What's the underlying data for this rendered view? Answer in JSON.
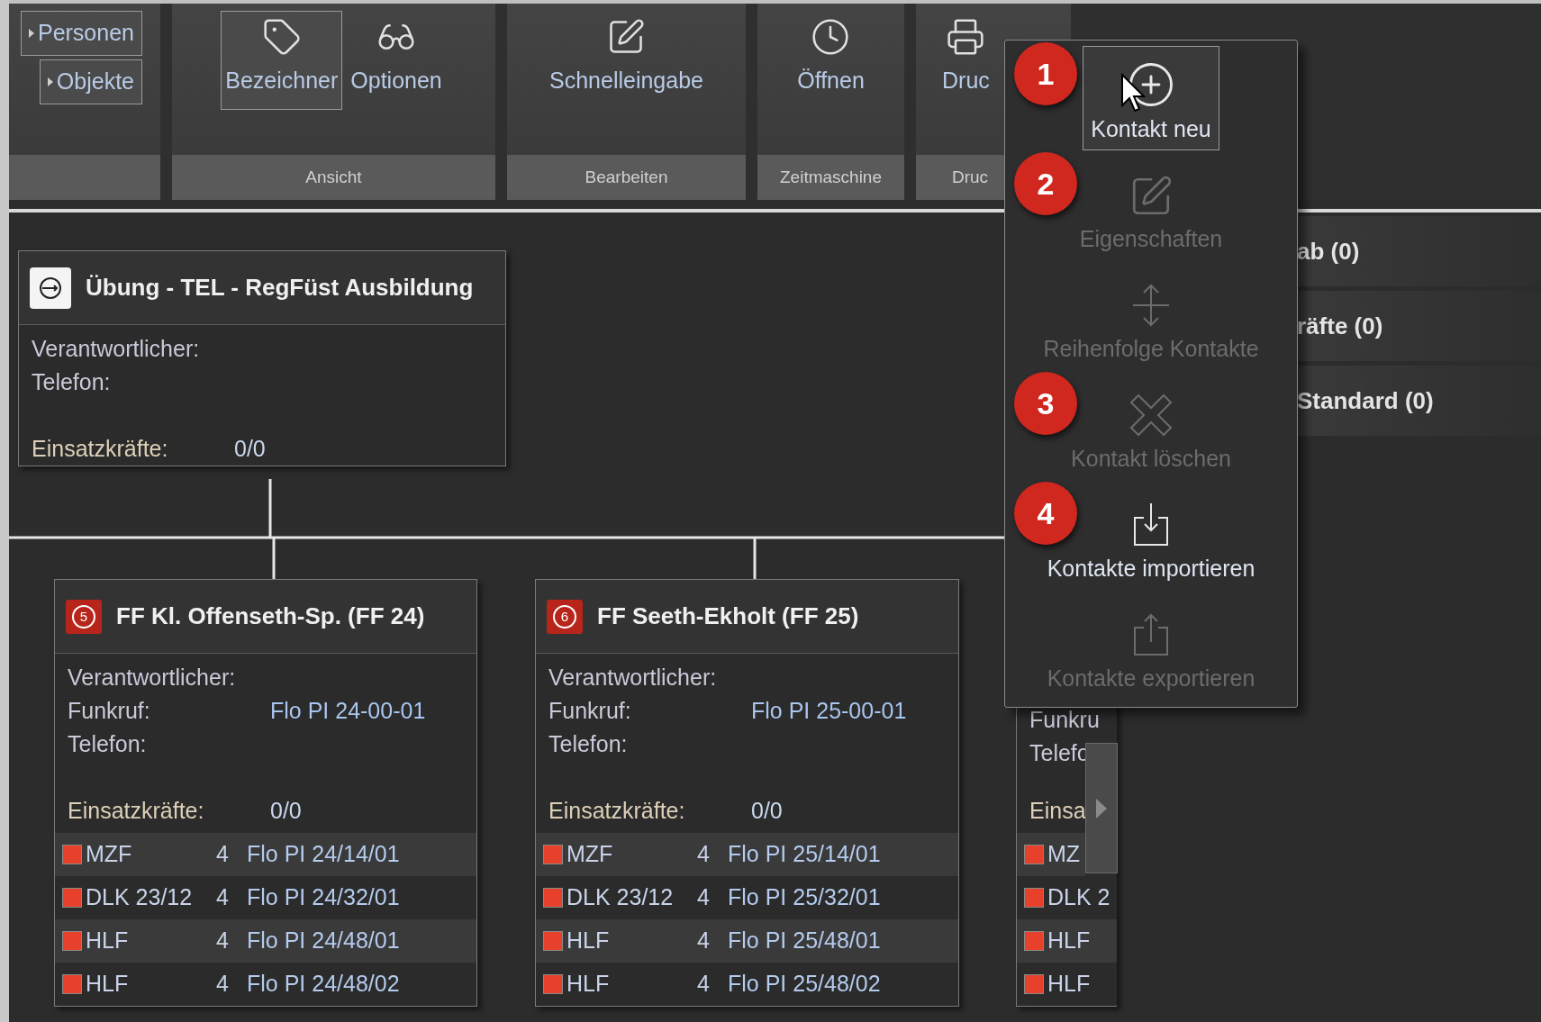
{
  "ribbon": {
    "groups": [
      {
        "buttons": [
          {
            "label": "Personen",
            "kind": "small",
            "selected": true
          },
          {
            "label": "Objekte",
            "kind": "small",
            "selected": true
          }
        ]
      },
      {
        "label": "Ansicht",
        "buttons": [
          {
            "label": "Bezeichner",
            "kind": "tag",
            "selected": true
          },
          {
            "label": "Optionen",
            "kind": "glasses",
            "selected": false
          }
        ]
      },
      {
        "label": "Bearbeiten",
        "buttons": [
          {
            "label": "Schnelleingabe",
            "kind": "edit",
            "selected": false
          }
        ]
      },
      {
        "label": "Zeitmaschine",
        "buttons": [
          {
            "label": "Öffnen",
            "kind": "clock",
            "selected": false
          }
        ]
      },
      {
        "label": "Druc",
        "buttons": [
          {
            "label": "Druc",
            "kind": "printer",
            "selected": false
          }
        ]
      }
    ]
  },
  "side_list": [
    "ab (0)",
    "räfte (0)",
    "Standard (0)"
  ],
  "cards": [
    {
      "kind": "exercise",
      "title": "Übung - TEL - RegFüst Ausbildung",
      "fields": [
        {
          "label": "Verantwortlicher:"
        },
        {
          "label": "Telefon:"
        }
      ],
      "strength": {
        "label": "Einsatzkräfte:",
        "value": "0/0"
      }
    },
    {
      "kind": "station",
      "badge": "5",
      "title": "FF Kl. Offenseth-Sp. (FF 24)",
      "fields": [
        {
          "label": "Verantwortlicher:"
        },
        {
          "label": "Funkruf:",
          "value": "Flo PI 24-00-01"
        },
        {
          "label": "Telefon:"
        }
      ],
      "strength": {
        "label": "Einsatzkräfte:",
        "value": "0/0"
      },
      "units": [
        {
          "name": "MZF",
          "crew": "4",
          "call": "Flo PI 24/14/01",
          "color": "#e8412b"
        },
        {
          "name": "DLK 23/12",
          "crew": "4",
          "call": "Flo PI 24/32/01",
          "color": "#e8412b"
        },
        {
          "name": "HLF",
          "crew": "4",
          "call": "Flo PI 24/48/01",
          "color": "#e8412b"
        },
        {
          "name": "HLF",
          "crew": "4",
          "call": "Flo PI 24/48/02",
          "color": "#e8412b"
        }
      ]
    },
    {
      "kind": "station",
      "badge": "6",
      "title": "FF Seeth-Ekholt (FF 25)",
      "fields": [
        {
          "label": "Verantwortlicher:"
        },
        {
          "label": "Funkruf:",
          "value": "Flo PI 25-00-01"
        },
        {
          "label": "Telefon:"
        }
      ],
      "strength": {
        "label": "Einsatzkräfte:",
        "value": "0/0"
      },
      "units": [
        {
          "name": "MZF",
          "crew": "4",
          "call": "Flo PI 25/14/01",
          "color": "#e8412b"
        },
        {
          "name": "DLK 23/12",
          "crew": "4",
          "call": "Flo PI 25/32/01",
          "color": "#e8412b"
        },
        {
          "name": "HLF",
          "crew": "4",
          "call": "Flo PI 25/48/01",
          "color": "#e8412b"
        },
        {
          "name": "HLF",
          "crew": "4",
          "call": "Flo PI 25/48/02",
          "color": "#e8412b"
        }
      ]
    },
    {
      "kind": "partial",
      "fields": [
        {
          "label": "Funkru"
        },
        {
          "label": "Telefo"
        }
      ],
      "strength": {
        "label": "Einsa"
      },
      "units": [
        {
          "name": "MZ",
          "color": "#e8412b"
        },
        {
          "name": "DLK 2",
          "color": "#e8412b"
        },
        {
          "name": "HLF",
          "color": "#e8412b"
        },
        {
          "name": "HLF",
          "color": "#e8412b"
        }
      ]
    }
  ],
  "context_menu": {
    "items": [
      {
        "label": "Kontakt neu",
        "kind": "add",
        "disabled": false,
        "highlighted": true,
        "badge": "1"
      },
      {
        "label": "Eigenschaften",
        "kind": "edit",
        "disabled": true,
        "highlighted": false,
        "badge": "2"
      },
      {
        "label": "Reihenfolge Kontakte",
        "kind": "reorder",
        "disabled": true,
        "highlighted": false
      },
      {
        "label": "Kontakt löschen",
        "kind": "delete",
        "disabled": true,
        "highlighted": false,
        "badge": "3"
      },
      {
        "label": "Kontakte importieren",
        "kind": "import",
        "disabled": false,
        "highlighted": false,
        "badge": "4"
      },
      {
        "label": "Kontakte exportieren",
        "kind": "export",
        "disabled": true,
        "highlighted": false
      }
    ]
  }
}
